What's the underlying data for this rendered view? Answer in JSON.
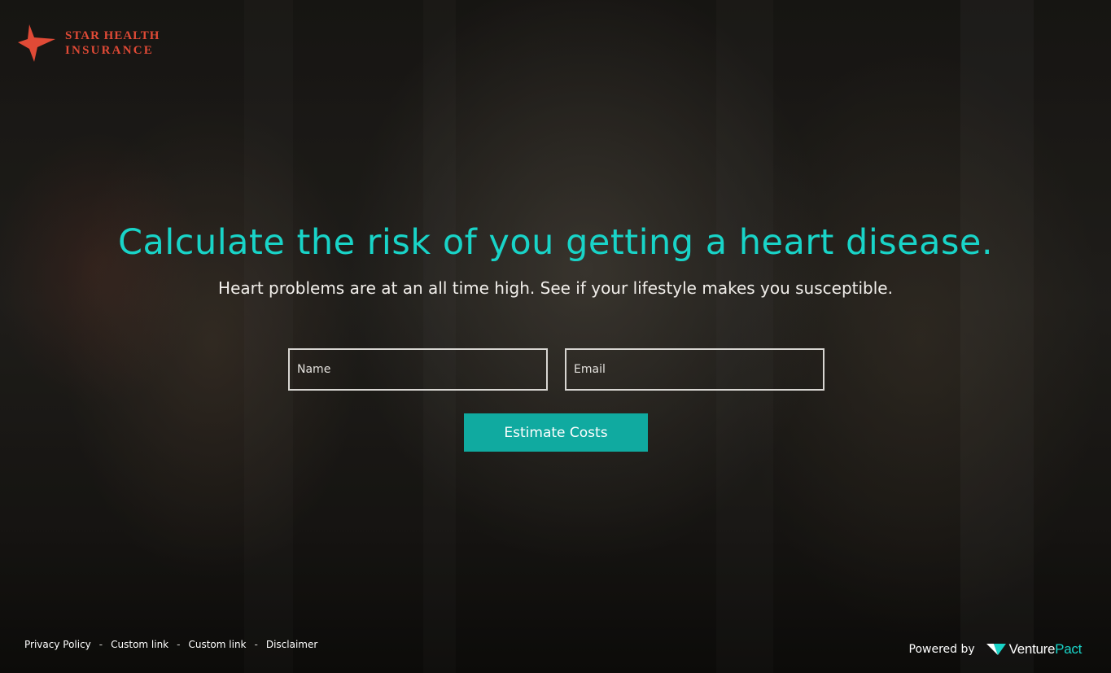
{
  "brand": {
    "line1": "STAR HEALTH",
    "line2": "INSURANCE",
    "accent_color": "#e04a36",
    "icon": "star-icon"
  },
  "hero": {
    "headline": "Calculate the risk of you getting a heart disease.",
    "subhead": "Heart problems are at an all time high. See if your lifestyle makes you susceptible.",
    "headline_color": "#19d4c8"
  },
  "form": {
    "name_placeholder": "Name",
    "email_placeholder": "Email",
    "submit_label": "Estimate Costs",
    "button_color": "#10aaa0"
  },
  "footer": {
    "links": [
      "Privacy Policy",
      "Custom link",
      "Custom link",
      "Disclaimer"
    ],
    "separator": "-",
    "powered_by": "Powered by",
    "vendor_part1": "Venture",
    "vendor_part2": "Pact",
    "vendor_icon": "venturepact-logo-icon"
  }
}
